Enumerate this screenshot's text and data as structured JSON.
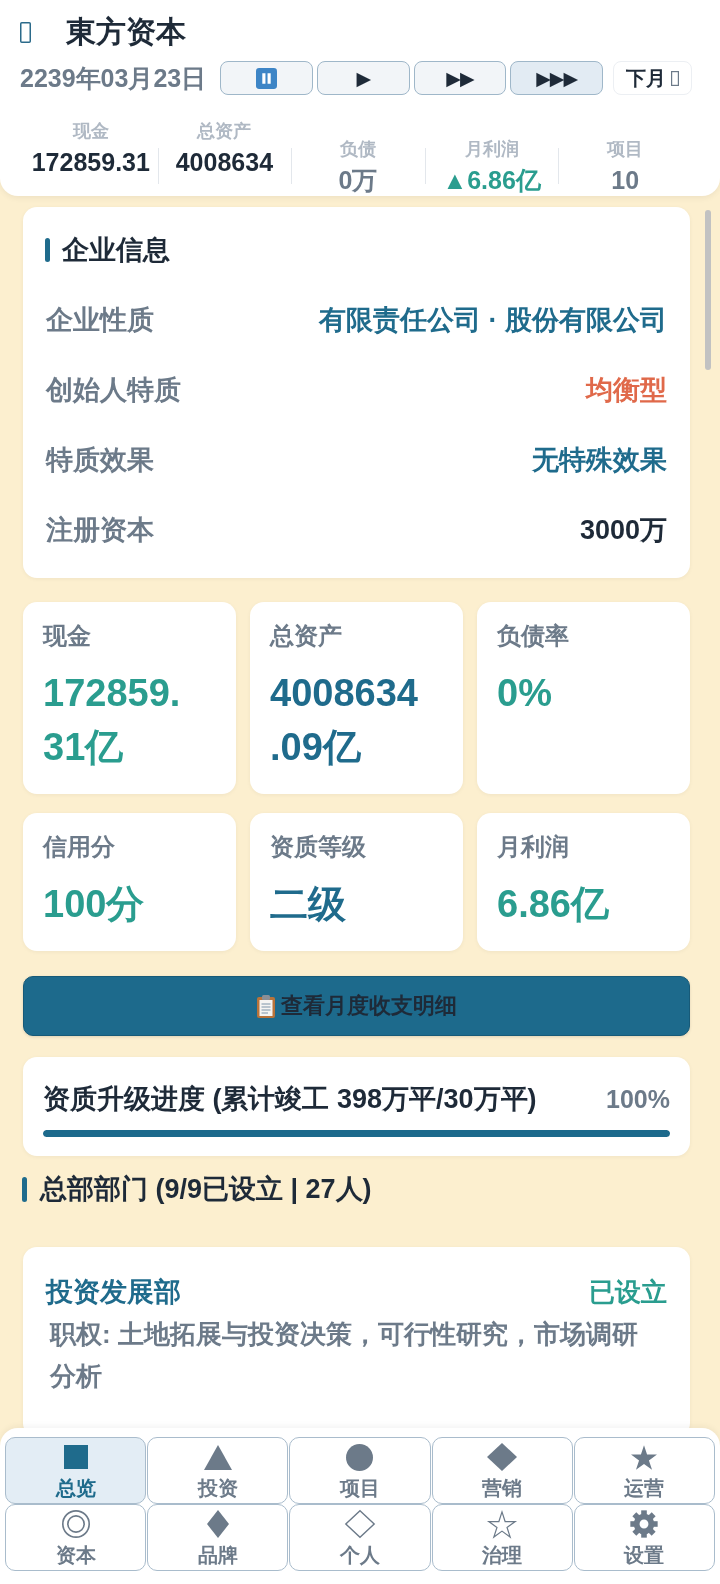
{
  "header": {
    "title": "東方资本",
    "date": "2239年03月23日",
    "speed_buttons": [
      {
        "kind": "pause",
        "selected": false
      },
      {
        "kind": "play",
        "label": "▶",
        "selected": false
      },
      {
        "kind": "play",
        "label": "▶▶",
        "selected": false
      },
      {
        "kind": "play",
        "label": "▶▶▶",
        "selected": true
      }
    ],
    "next_button": {
      "label": "下月"
    },
    "stats": [
      {
        "label": "现金",
        "value": "172859.31",
        "color": "#1e2a38"
      },
      {
        "label": "总资产",
        "value": "4008634",
        "color": "#1e2a38"
      },
      {
        "label": "负债",
        "value": "0万",
        "color": "#6c7a89"
      },
      {
        "label": "月利润",
        "value": "▲6.86亿",
        "color": "#2a9d8f"
      },
      {
        "label": "项目",
        "value": "10",
        "color": "#6c7a89"
      }
    ]
  },
  "company_info": {
    "title": "企业信息",
    "rows": [
      {
        "label": "企业性质",
        "value": "有限责任公司 · 股份有限公司",
        "color": "#1f6b8c"
      },
      {
        "label": "创始人特质",
        "value": "均衡型",
        "color": "#e0694a"
      },
      {
        "label": "特质效果",
        "value": "无特殊效果",
        "color": "#1f6b8c"
      },
      {
        "label": "注册资本",
        "value": "3000万",
        "color": "#1e2a38"
      }
    ]
  },
  "metrics": [
    {
      "label": "现金",
      "value": "172859.31亿",
      "color": "#2a9d8f"
    },
    {
      "label": "总资产",
      "value": "4008634.09亿",
      "color": "#1f6b8c"
    },
    {
      "label": "负债率",
      "value": "0%",
      "color": "#2a9d8f"
    },
    {
      "label": "信用分",
      "value": "100分",
      "color": "#2a9d8f"
    },
    {
      "label": "资质等级",
      "value": "二级",
      "color": "#1f6b8c"
    },
    {
      "label": "月利润",
      "value": "6.86亿",
      "color": "#2a9d8f"
    }
  ],
  "detail_button": {
    "label": "查看月度收支明细"
  },
  "progress": {
    "label": "资质升级进度 (累计竣工 398万平/30万平)",
    "percent": "100%",
    "level": 1
  },
  "departments_section": {
    "title": "总部部门 (9/9已设立 | 27人)",
    "departments": [
      {
        "name": "投资发展部",
        "status": "已设立",
        "established": true,
        "duties": "职权: 土地拓展与投资决策，可行性研究，市场调研分析"
      }
    ]
  },
  "nav": [
    {
      "label": "总览",
      "selected": true
    },
    {
      "label": "投资",
      "selected": false
    },
    {
      "label": "项目",
      "selected": false
    },
    {
      "label": "营销",
      "selected": false
    },
    {
      "label": "运营",
      "selected": false
    },
    {
      "label": "资本",
      "selected": false
    },
    {
      "label": "品牌",
      "selected": false
    },
    {
      "label": "个人",
      "selected": false
    },
    {
      "label": "治理",
      "selected": false
    },
    {
      "label": "设置",
      "selected": false
    }
  ]
}
